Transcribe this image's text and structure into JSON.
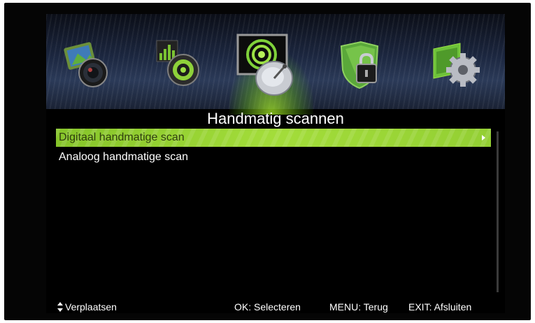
{
  "tabs": [
    {
      "icon": "picture-icon",
      "active": false
    },
    {
      "icon": "sound-icon",
      "active": false
    },
    {
      "icon": "channel-satellite-icon",
      "active": true
    },
    {
      "icon": "lock-icon",
      "active": false
    },
    {
      "icon": "setup-gear-icon",
      "active": false
    }
  ],
  "menu": {
    "title": "Handmatig scannen",
    "items": [
      {
        "label": "Digitaal handmatige scan",
        "selected": true
      },
      {
        "label": "Analoog handmatige scan",
        "selected": false
      }
    ]
  },
  "footer": {
    "move": "Verplaatsen",
    "ok": "OK: Selecteren",
    "menu": "MENU: Terug",
    "exit": "EXIT: Afsluiten"
  },
  "colors": {
    "highlight": "#9ad636",
    "background": "#000000",
    "text": "#ffffff"
  }
}
